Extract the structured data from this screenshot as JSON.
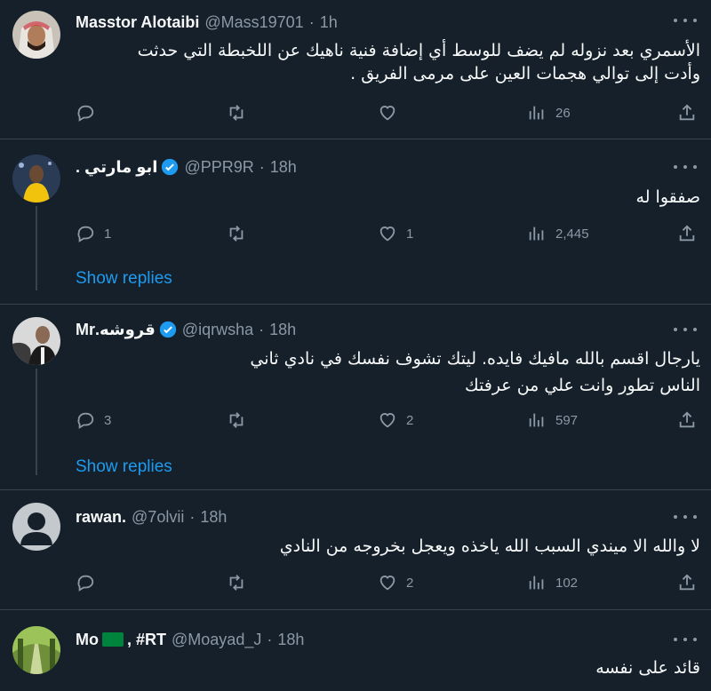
{
  "tweets": [
    {
      "name": "Masstor Alotaibi",
      "handle": "@Mass19701",
      "sep": "·",
      "time": "1h",
      "verified": false,
      "lines": [
        "الأسمري بعد نزوله لم يضف للوسط أي إضافة فنية ناهيك عن اللخبطة التي حدثت",
        "وأدت إلى توالي هجمات العين على مرمى الفريق ."
      ],
      "replies": "",
      "retweets": "",
      "likes": "",
      "views": "26"
    },
    {
      "name": "ابو مارتي .",
      "handle": "@PPR9R",
      "sep": "·",
      "time": "18h",
      "verified": true,
      "lines": [
        "صفقوا له"
      ],
      "replies": "1",
      "retweets": "",
      "likes": "1",
      "views": "2,445",
      "show_replies": "Show replies"
    },
    {
      "name": "قروشه.Mr",
      "handle": "@iqrwsha",
      "sep": "·",
      "time": "18h",
      "verified": true,
      "lines": [
        "يارجال اقسم بالله مافيك فايده. ليتك تشوف نفسك في نادي ثاني",
        "الناس تطور وانت علي من عرفتك"
      ],
      "replies": "3",
      "retweets": "",
      "likes": "2",
      "views": "597",
      "show_replies": "Show replies"
    },
    {
      "name": "rawan.",
      "handle": "@7olvii",
      "sep": "·",
      "time": "18h",
      "verified": false,
      "lines": [
        "لا والله الا ميندي السبب الله ياخذه ويعجل بخروجه من النادي"
      ],
      "replies": "",
      "retweets": "",
      "likes": "2",
      "views": "102"
    },
    {
      "name_prefix": "Mo",
      "name_suffix": ", #RT",
      "handle": "@Moayad_J",
      "sep": "·",
      "time": "18h",
      "verified": false,
      "lines": [
        "قائد على نفسه"
      ]
    }
  ],
  "colors": {
    "background": "#15202b",
    "divider": "#38444d",
    "link": "#1d9bf0",
    "muted": "#8b98a5",
    "verified": "#1d9bf0"
  },
  "icons": [
    "reply-icon",
    "retweet-icon",
    "like-icon",
    "views-icon",
    "share-icon",
    "more-icon",
    "verified-icon"
  ]
}
